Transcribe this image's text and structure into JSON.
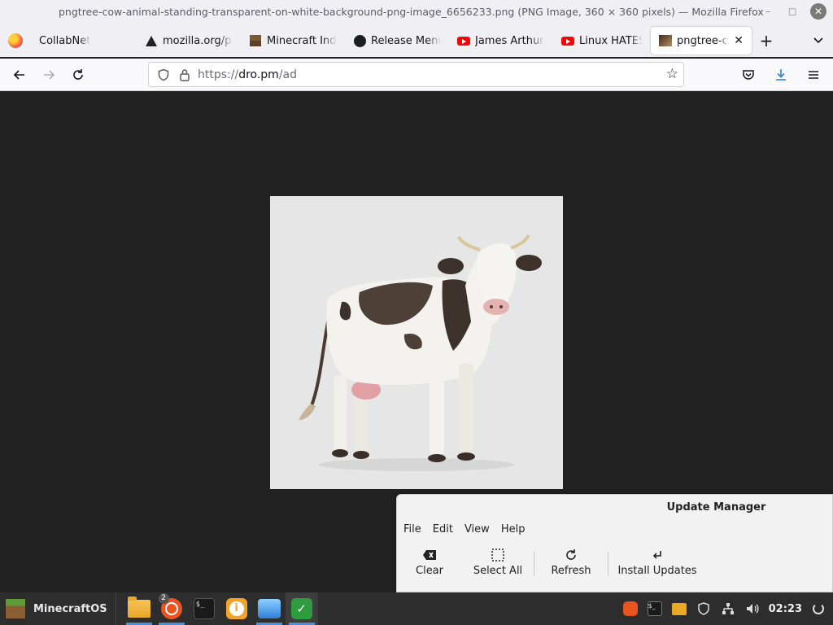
{
  "window": {
    "title": "pngtree-cow-animal-standing-transparent-on-white-background-png-image_6656233.png (PNG Image, 360 × 360 pixels) — Mozilla Firefox"
  },
  "tabs": [
    {
      "label": "CollabNet",
      "icon": "none"
    },
    {
      "label": "mozilla.org/pr",
      "icon": "warning-icon"
    },
    {
      "label": "Minecraft Inde",
      "icon": "minecraft-icon"
    },
    {
      "label": "Release Menu",
      "icon": "github-icon"
    },
    {
      "label": "James Arthur",
      "icon": "youtube-icon"
    },
    {
      "label": "Linux HATES M",
      "icon": "youtube-icon"
    },
    {
      "label": "pngtree-cow",
      "icon": "image-thumbnail-icon",
      "active": true
    }
  ],
  "navbar": {
    "url_scheme": "https://",
    "url_host": "dro.pm",
    "url_path": "/ad"
  },
  "update_manager": {
    "title": "Update Manager",
    "menu": [
      "File",
      "Edit",
      "View",
      "Help"
    ],
    "toolbar": {
      "clear": "Clear",
      "select_all": "Select All",
      "refresh": "Refresh",
      "install_updates": "Install Updates"
    }
  },
  "taskbar": {
    "start_label": "MinecraftOS",
    "ubuntu_badge": "2",
    "terminal_glyph": "$_",
    "clock": "02:23"
  },
  "colors": {
    "content_bg": "#222222",
    "taskbar_bg": "#2d2d2d",
    "accent_blue": "#4a90d9",
    "ubuntu_orange": "#e95420"
  }
}
